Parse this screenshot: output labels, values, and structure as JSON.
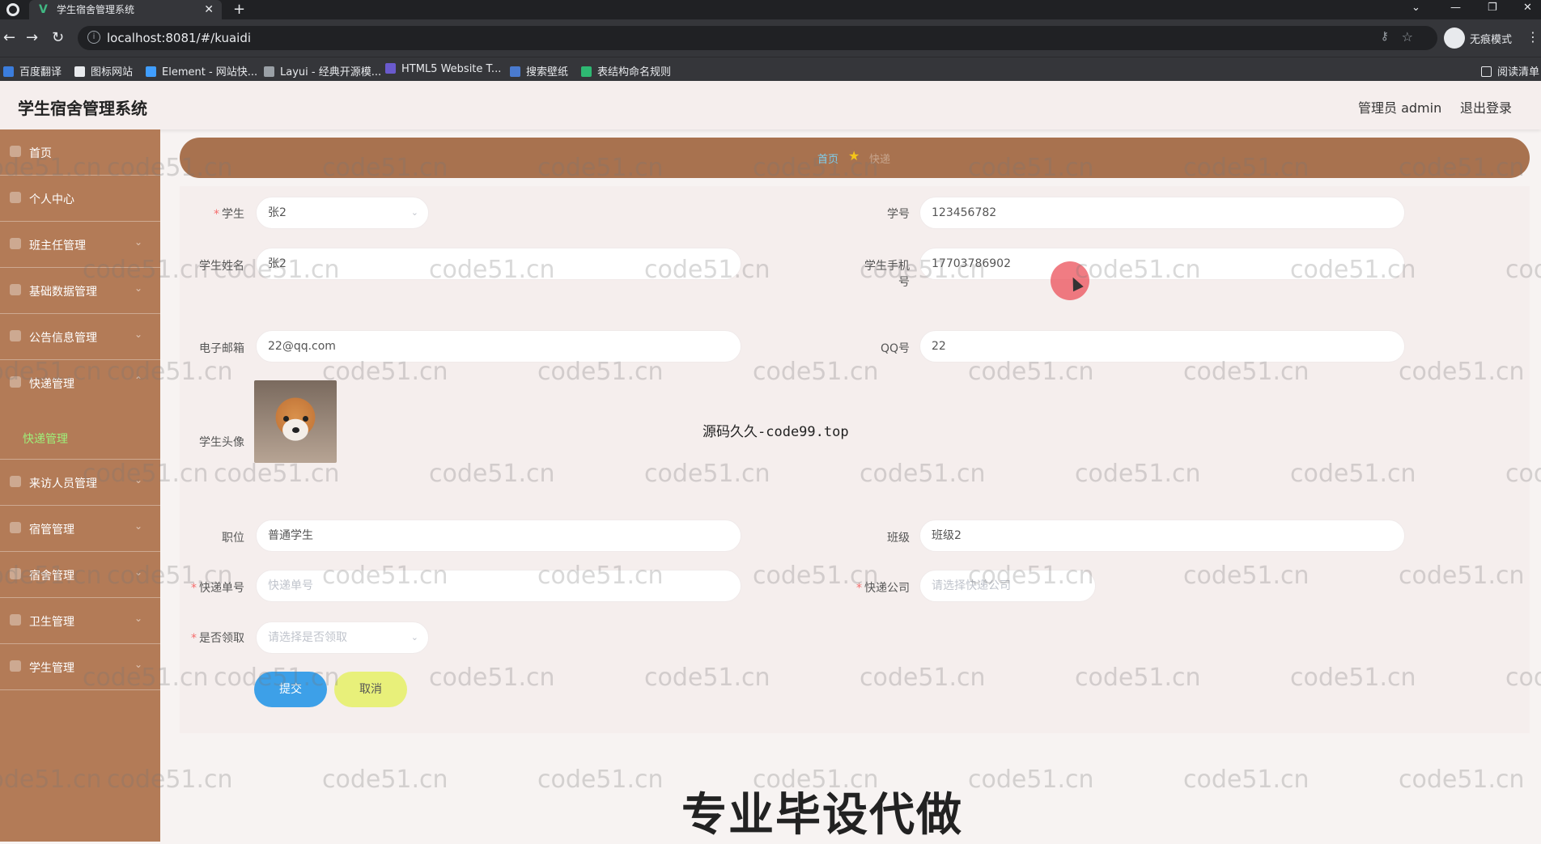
{
  "browser": {
    "tab_title": "学生宿舍管理系统",
    "url": "localhost:8081/#/kuaidi",
    "incognito_label": "无痕模式",
    "reading_list_label": "阅读清单",
    "bookmarks": [
      "百度翻译",
      "图标网站",
      "Element - 网站快...",
      "Layui - 经典开源模...",
      "HTML5 Website T...",
      "搜索壁纸",
      "表结构命名规则"
    ]
  },
  "header": {
    "title": "学生宿舍管理系统",
    "admin": "管理员 admin",
    "logout": "退出登录"
  },
  "sidebar": {
    "items": [
      {
        "label": "首页"
      },
      {
        "label": "个人中心"
      },
      {
        "label": "班主任管理"
      },
      {
        "label": "基础数据管理"
      },
      {
        "label": "公告信息管理"
      },
      {
        "label": "快递管理"
      },
      {
        "label": "来访人员管理"
      },
      {
        "label": "宿管管理"
      },
      {
        "label": "宿舍管理"
      },
      {
        "label": "卫生管理"
      },
      {
        "label": "学生管理"
      }
    ],
    "active_sub": "快递管理"
  },
  "breadcrumb": {
    "home": "首页",
    "current": "快递"
  },
  "form": {
    "student_label": "学生",
    "student_value": "张2",
    "student_no_label": "学号",
    "student_no_value": "123456782",
    "name_label": "学生姓名",
    "name_value": "张2",
    "phone_label_1": "学生手机",
    "phone_label_2": "号",
    "phone_value": "17703786902",
    "email_label": "电子邮箱",
    "email_value": "22@qq.com",
    "qq_label": "QQ号",
    "qq_value": "22",
    "avatar_label": "学生头像",
    "position_label": "职位",
    "position_value": "普通学生",
    "class_label": "班级",
    "class_value": "班级2",
    "tracking_label": "快递单号",
    "tracking_placeholder": "快递单号",
    "company_label": "快递公司",
    "company_placeholder": "请选择快递公司",
    "received_label": "是否领取",
    "received_placeholder": "请选择是否领取",
    "submit": "提交",
    "cancel": "取消"
  },
  "overlay": {
    "source_text": "源码久久-code99.top",
    "banner": "专业毕设代做",
    "watermark": "code51.cn"
  },
  "colors": {
    "sidebar": "#b37b57",
    "breadcrumb": "#a8724f",
    "submit": "#3da0e8",
    "cancel": "#e8f07a",
    "active_sub": "#9ef07a"
  }
}
